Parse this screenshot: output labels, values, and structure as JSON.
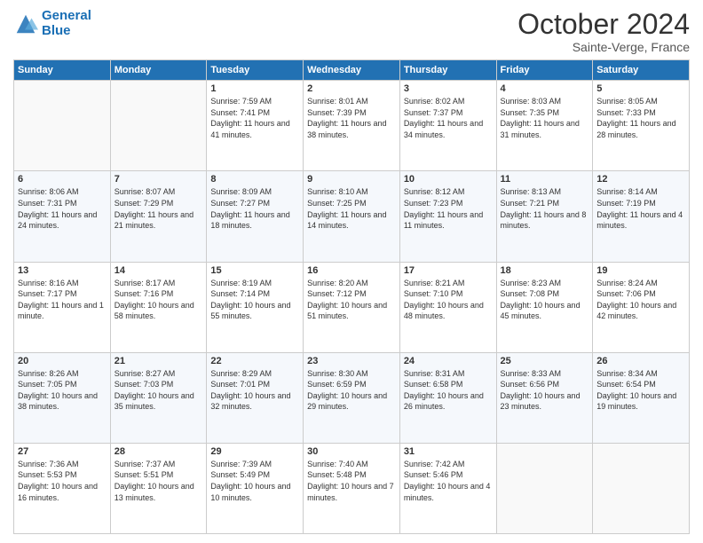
{
  "header": {
    "logo_line1": "General",
    "logo_line2": "Blue",
    "month": "October 2024",
    "location": "Sainte-Verge, France"
  },
  "weekdays": [
    "Sunday",
    "Monday",
    "Tuesday",
    "Wednesday",
    "Thursday",
    "Friday",
    "Saturday"
  ],
  "weeks": [
    [
      {
        "day": "",
        "info": ""
      },
      {
        "day": "",
        "info": ""
      },
      {
        "day": "1",
        "info": "Sunrise: 7:59 AM\nSunset: 7:41 PM\nDaylight: 11 hours and 41 minutes."
      },
      {
        "day": "2",
        "info": "Sunrise: 8:01 AM\nSunset: 7:39 PM\nDaylight: 11 hours and 38 minutes."
      },
      {
        "day": "3",
        "info": "Sunrise: 8:02 AM\nSunset: 7:37 PM\nDaylight: 11 hours and 34 minutes."
      },
      {
        "day": "4",
        "info": "Sunrise: 8:03 AM\nSunset: 7:35 PM\nDaylight: 11 hours and 31 minutes."
      },
      {
        "day": "5",
        "info": "Sunrise: 8:05 AM\nSunset: 7:33 PM\nDaylight: 11 hours and 28 minutes."
      }
    ],
    [
      {
        "day": "6",
        "info": "Sunrise: 8:06 AM\nSunset: 7:31 PM\nDaylight: 11 hours and 24 minutes."
      },
      {
        "day": "7",
        "info": "Sunrise: 8:07 AM\nSunset: 7:29 PM\nDaylight: 11 hours and 21 minutes."
      },
      {
        "day": "8",
        "info": "Sunrise: 8:09 AM\nSunset: 7:27 PM\nDaylight: 11 hours and 18 minutes."
      },
      {
        "day": "9",
        "info": "Sunrise: 8:10 AM\nSunset: 7:25 PM\nDaylight: 11 hours and 14 minutes."
      },
      {
        "day": "10",
        "info": "Sunrise: 8:12 AM\nSunset: 7:23 PM\nDaylight: 11 hours and 11 minutes."
      },
      {
        "day": "11",
        "info": "Sunrise: 8:13 AM\nSunset: 7:21 PM\nDaylight: 11 hours and 8 minutes."
      },
      {
        "day": "12",
        "info": "Sunrise: 8:14 AM\nSunset: 7:19 PM\nDaylight: 11 hours and 4 minutes."
      }
    ],
    [
      {
        "day": "13",
        "info": "Sunrise: 8:16 AM\nSunset: 7:17 PM\nDaylight: 11 hours and 1 minute."
      },
      {
        "day": "14",
        "info": "Sunrise: 8:17 AM\nSunset: 7:16 PM\nDaylight: 10 hours and 58 minutes."
      },
      {
        "day": "15",
        "info": "Sunrise: 8:19 AM\nSunset: 7:14 PM\nDaylight: 10 hours and 55 minutes."
      },
      {
        "day": "16",
        "info": "Sunrise: 8:20 AM\nSunset: 7:12 PM\nDaylight: 10 hours and 51 minutes."
      },
      {
        "day": "17",
        "info": "Sunrise: 8:21 AM\nSunset: 7:10 PM\nDaylight: 10 hours and 48 minutes."
      },
      {
        "day": "18",
        "info": "Sunrise: 8:23 AM\nSunset: 7:08 PM\nDaylight: 10 hours and 45 minutes."
      },
      {
        "day": "19",
        "info": "Sunrise: 8:24 AM\nSunset: 7:06 PM\nDaylight: 10 hours and 42 minutes."
      }
    ],
    [
      {
        "day": "20",
        "info": "Sunrise: 8:26 AM\nSunset: 7:05 PM\nDaylight: 10 hours and 38 minutes."
      },
      {
        "day": "21",
        "info": "Sunrise: 8:27 AM\nSunset: 7:03 PM\nDaylight: 10 hours and 35 minutes."
      },
      {
        "day": "22",
        "info": "Sunrise: 8:29 AM\nSunset: 7:01 PM\nDaylight: 10 hours and 32 minutes."
      },
      {
        "day": "23",
        "info": "Sunrise: 8:30 AM\nSunset: 6:59 PM\nDaylight: 10 hours and 29 minutes."
      },
      {
        "day": "24",
        "info": "Sunrise: 8:31 AM\nSunset: 6:58 PM\nDaylight: 10 hours and 26 minutes."
      },
      {
        "day": "25",
        "info": "Sunrise: 8:33 AM\nSunset: 6:56 PM\nDaylight: 10 hours and 23 minutes."
      },
      {
        "day": "26",
        "info": "Sunrise: 8:34 AM\nSunset: 6:54 PM\nDaylight: 10 hours and 19 minutes."
      }
    ],
    [
      {
        "day": "27",
        "info": "Sunrise: 7:36 AM\nSunset: 5:53 PM\nDaylight: 10 hours and 16 minutes."
      },
      {
        "day": "28",
        "info": "Sunrise: 7:37 AM\nSunset: 5:51 PM\nDaylight: 10 hours and 13 minutes."
      },
      {
        "day": "29",
        "info": "Sunrise: 7:39 AM\nSunset: 5:49 PM\nDaylight: 10 hours and 10 minutes."
      },
      {
        "day": "30",
        "info": "Sunrise: 7:40 AM\nSunset: 5:48 PM\nDaylight: 10 hours and 7 minutes."
      },
      {
        "day": "31",
        "info": "Sunrise: 7:42 AM\nSunset: 5:46 PM\nDaylight: 10 hours and 4 minutes."
      },
      {
        "day": "",
        "info": ""
      },
      {
        "day": "",
        "info": ""
      }
    ]
  ]
}
